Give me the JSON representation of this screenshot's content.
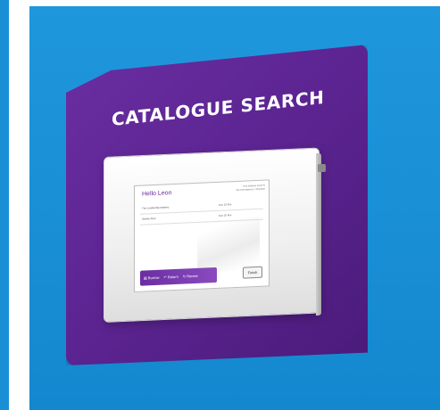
{
  "sign": {
    "title": "CATALOGUE SEARCH"
  },
  "screen": {
    "greeting": "Hello Leon",
    "status_lines": [
      "Your balance is £0.75",
      "No reservations | 1 Overdue"
    ],
    "loans": [
      {
        "title": "The Leadership mystery",
        "due": "Due 20 Mar"
      },
      {
        "title": "Jimmie Pear",
        "due": "Due 20 Mar"
      }
    ],
    "nav": {
      "borrow_label": "Borrow",
      "return_label": "Return",
      "renew_label": "Renew"
    },
    "finish_label": "Finish"
  },
  "colors": {
    "background_blue": "#1b8fd6",
    "sign_purple": "#5a238f",
    "accent_purple": "#6a2ea2"
  },
  "icons": {
    "borrow": "book-icon",
    "return": "return-icon",
    "renew": "renew-icon"
  }
}
